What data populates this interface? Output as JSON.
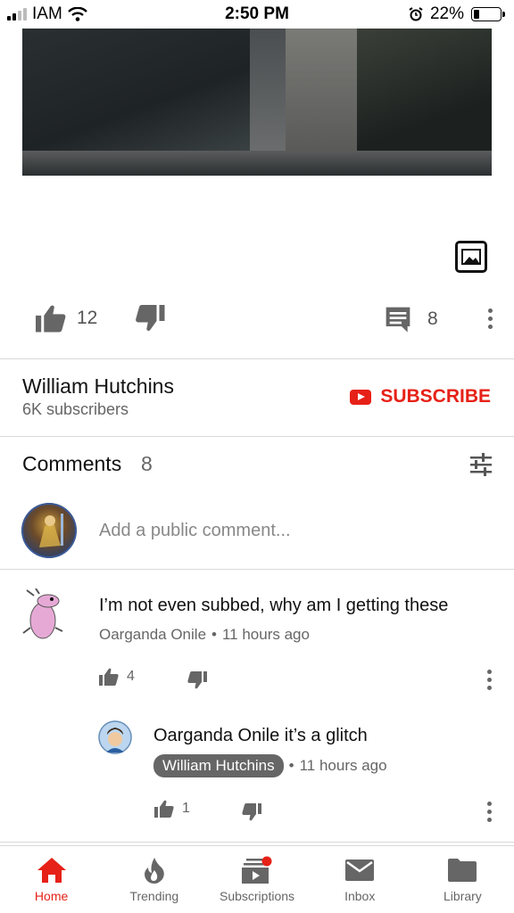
{
  "status_bar": {
    "carrier": "IAM",
    "time": "2:50 PM",
    "battery_percent": "22%",
    "battery_level": 0.22
  },
  "video": {
    "overlay_icon": "image-icon"
  },
  "actions": {
    "like_count": "12",
    "comment_count": "8"
  },
  "channel": {
    "name": "William Hutchins",
    "subscribers": "6K subscribers",
    "subscribe_label": "SUBSCRIBE"
  },
  "comments": {
    "title": "Comments",
    "count": "8",
    "add_placeholder": "Add a public comment...",
    "items": [
      {
        "text": "I’m not even subbed, why am I getting these",
        "author": "Oarganda Onile",
        "time": "11 hours ago",
        "likes": "4"
      }
    ],
    "reply": {
      "text": "Oarganda Onile it’s a glitch",
      "author": "William Hutchins",
      "time": "11 hours ago",
      "likes": "1"
    }
  },
  "nav": {
    "items": [
      {
        "label": "Home",
        "icon": "home-icon",
        "active": true
      },
      {
        "label": "Trending",
        "icon": "flame-icon"
      },
      {
        "label": "Subscriptions",
        "icon": "subscriptions-icon"
      },
      {
        "label": "Inbox",
        "icon": "mail-icon"
      },
      {
        "label": "Library",
        "icon": "folder-icon"
      }
    ]
  },
  "colors": {
    "accent": "#e62117",
    "muted": "#666666"
  }
}
